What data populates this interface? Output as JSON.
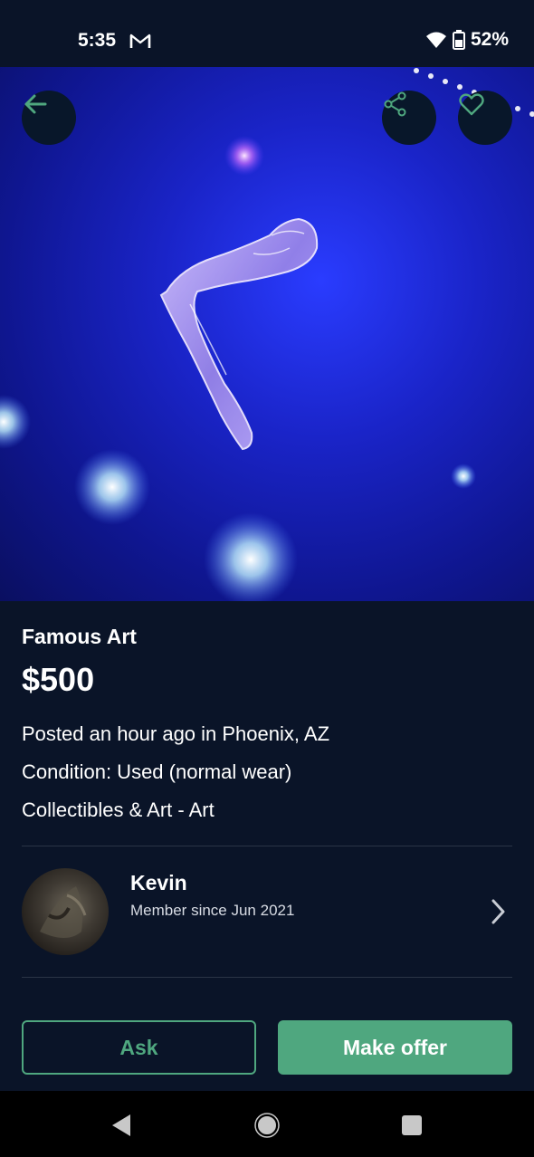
{
  "status_bar": {
    "time": "5:35",
    "battery_pct": "52%",
    "icons": [
      "gmail-icon",
      "wifi-icon",
      "battery-icon"
    ]
  },
  "listing": {
    "title": "Famous Art",
    "price": "$500",
    "posted": "Posted an hour ago in Phoenix, AZ",
    "condition": "Condition: Used (normal wear)",
    "category": "Collectibles & Art - Art"
  },
  "seller": {
    "name": "Kevin",
    "member_since": "Member since Jun 2021"
  },
  "actions": {
    "ask_label": "Ask",
    "offer_label": "Make offer"
  },
  "colors": {
    "background": "#0a1428",
    "accent": "#4fa77f"
  }
}
